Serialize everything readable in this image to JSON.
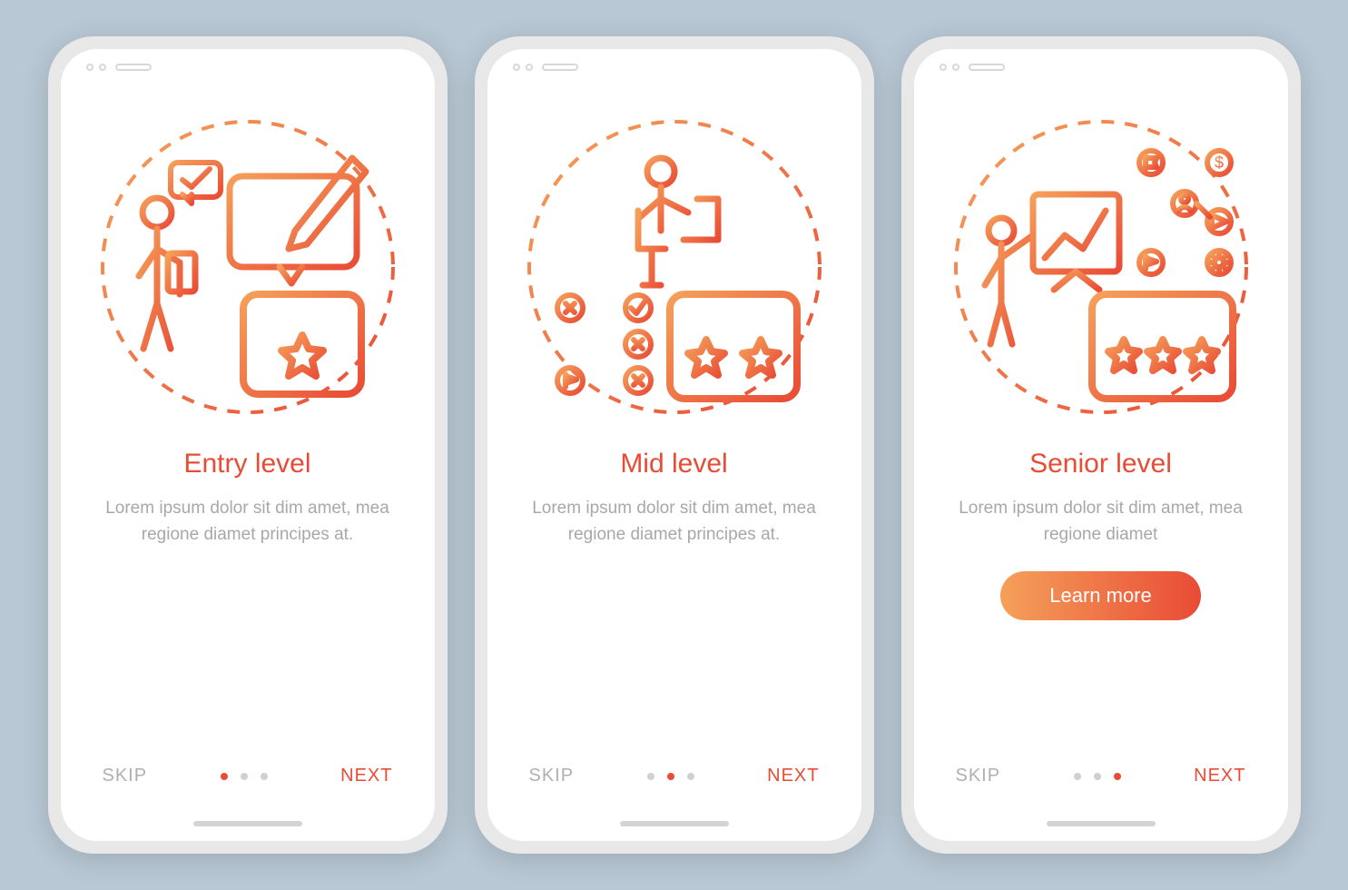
{
  "screens": [
    {
      "title": "Entry level",
      "desc": "Lorem ipsum dolor sit dim amet, mea regione diamet principes at.",
      "skip": "SKIP",
      "next": "NEXT",
      "stars": 1,
      "activeDot": 0,
      "cta": null
    },
    {
      "title": "Mid level",
      "desc": "Lorem ipsum dolor sit dim amet, mea regione diamet principes at.",
      "skip": "SKIP",
      "next": "NEXT",
      "stars": 2,
      "activeDot": 1,
      "cta": null
    },
    {
      "title": "Senior level",
      "desc": "Lorem ipsum dolor sit dim amet, mea regione diamet",
      "skip": "SKIP",
      "next": "NEXT",
      "stars": 3,
      "activeDot": 2,
      "cta": "Learn more"
    }
  ],
  "colors": {
    "gradientStart": "#f5a05a",
    "gradientEnd": "#e94b35",
    "accent": "#e94b35"
  }
}
